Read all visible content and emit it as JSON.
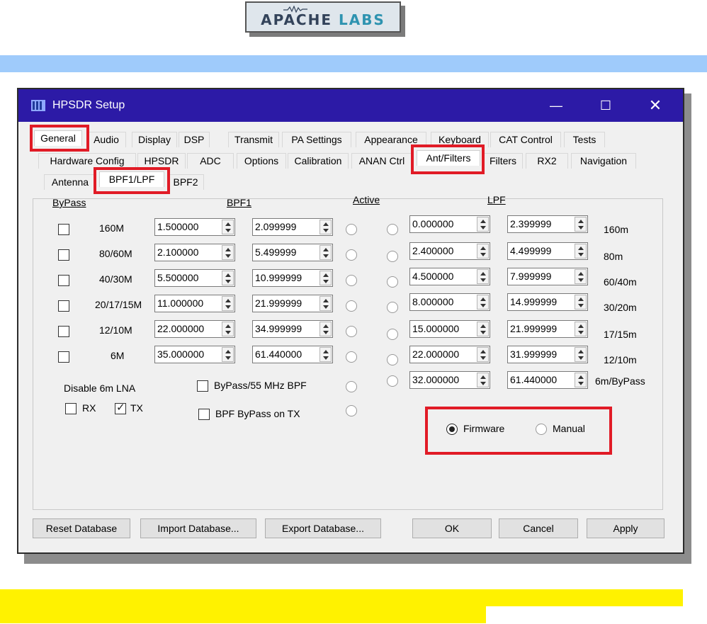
{
  "logo": {
    "brand": "APACHE",
    "brand_suffix": "LABS"
  },
  "window": {
    "title": "HPSDR Setup"
  },
  "tabs_row1": [
    "General",
    "Audio",
    "Display",
    "DSP",
    "Transmit",
    "PA Settings",
    "Appearance",
    "Keyboard",
    "CAT Control",
    "Tests"
  ],
  "tabs_row2": [
    "Hardware Config",
    "HPSDR",
    "ADC",
    "Options",
    "Calibration",
    "ANAN Ctrl",
    "Ant/Filters",
    "Filters",
    "RX2",
    "Navigation"
  ],
  "tabs_row3": [
    "Antenna",
    "BPF1/LPF",
    "BPF2"
  ],
  "headers": {
    "bypass": "ByPass",
    "bpf1": "BPF1",
    "active": "Active",
    "lpf": "LPF"
  },
  "bpf_rows": [
    {
      "band": "160M",
      "low": "1.500000",
      "high": "2.099999"
    },
    {
      "band": "80/60M",
      "low": "2.100000",
      "high": "5.499999"
    },
    {
      "band": "40/30M",
      "low": "5.500000",
      "high": "10.999999"
    },
    {
      "band": "20/17/15M",
      "low": "11.000000",
      "high": "21.999999"
    },
    {
      "band": "12/10M",
      "low": "22.000000",
      "high": "34.999999"
    },
    {
      "band": "6M",
      "low": "35.000000",
      "high": "61.440000"
    }
  ],
  "lpf_rows": [
    {
      "low": "0.000000",
      "high": "2.399999",
      "band": "160m"
    },
    {
      "low": "2.400000",
      "high": "4.499999",
      "band": "80m"
    },
    {
      "low": "4.500000",
      "high": "7.999999",
      "band": "60/40m"
    },
    {
      "low": "8.000000",
      "high": "14.999999",
      "band": "30/20m"
    },
    {
      "low": "15.000000",
      "high": "21.999999",
      "band": "17/15m"
    },
    {
      "low": "22.000000",
      "high": "31.999999",
      "band": "12/10m"
    },
    {
      "low": "32.000000",
      "high": "61.440000",
      "band": "6m/ByPass"
    }
  ],
  "lna": {
    "label": "Disable 6m LNA",
    "rx": "RX",
    "tx": "TX",
    "rx_checked": false,
    "tx_checked": true
  },
  "bypass55": "ByPass/55 MHz BPF",
  "bpf_bypass_tx": "BPF ByPass on TX",
  "mode": {
    "firmware": "Firmware",
    "manual": "Manual",
    "selected": "Firmware"
  },
  "buttons": {
    "reset": "Reset Database",
    "import": "Import Database...",
    "export": "Export Database...",
    "ok": "OK",
    "cancel": "Cancel",
    "apply": "Apply"
  },
  "colors": {
    "titlebar": "#2c1aa6",
    "highlight": "#e11b26",
    "blue_band": "#9fcbfb",
    "yellow_band": "#fff200"
  }
}
